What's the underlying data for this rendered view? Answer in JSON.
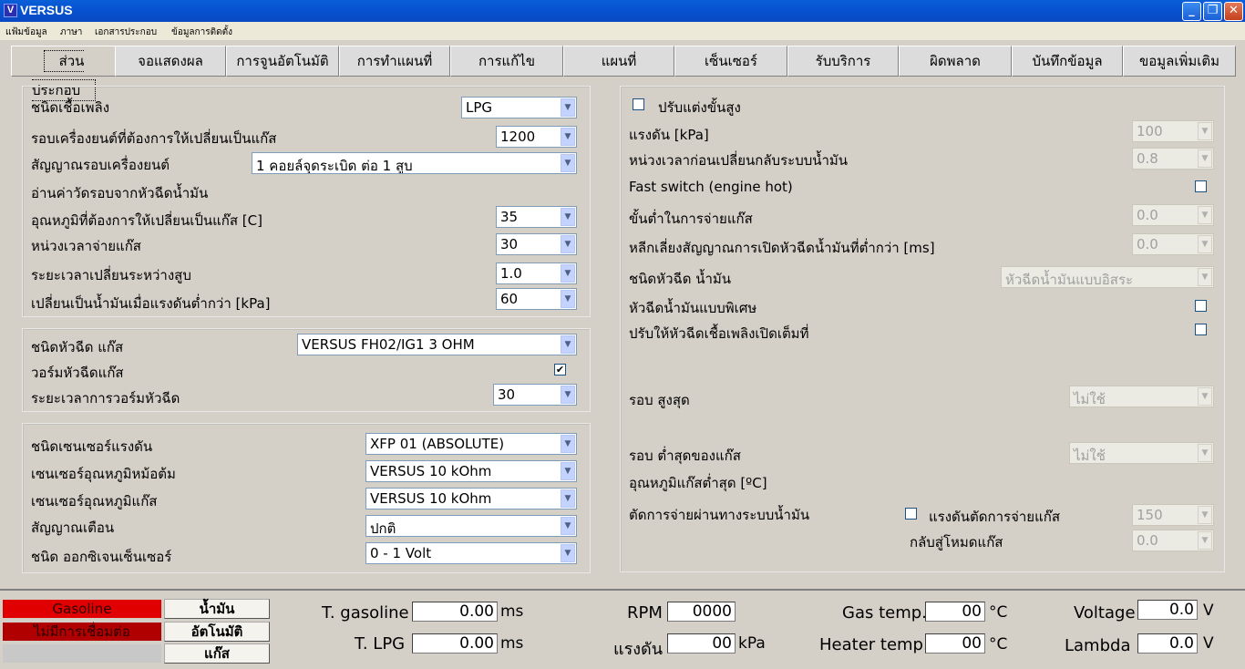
{
  "window": {
    "title": "VERSUS",
    "icon": "versus-logo-icon"
  },
  "menu": [
    "แฟ้มข้อมูล",
    "ภาษา",
    "เอกสารประกอบ",
    "ข้อมูลการติดตั้ง"
  ],
  "tabs": [
    "ส่วนประกอบ",
    "จอแสดงผล",
    "การจูนอัตโนมัติ",
    "การทำแผนที่",
    "การแก้ไข",
    "แผนที่",
    "เซ็นเซอร์",
    "รับบริการ",
    "ผิดพลาด",
    "บันทึกข้อมูล",
    "ขอมูลเพิ่มเติม"
  ],
  "left": {
    "fuel_type": {
      "label": "ชนิดเชื้อเพลิง",
      "value": "LPG"
    },
    "switch_rpm": {
      "label": "รอบเครื่องยนต์ที่ต้องการให้เปลี่ยนเป็นแก๊ส",
      "value": "1200"
    },
    "rpm_signal": {
      "label": "สัญญาณรอบเครื่องยนต์",
      "value": "1 คอยล์จุดระเบิด ต่อ 1 สูบ"
    },
    "read_rpm_label": "อ่านค่าวัดรอบจากหัวฉีดน้ำมัน",
    "switch_temp": {
      "label": "อุณหภูมิที่ต้องการให้เปลี่ยนเป็นแก๊ส [C]",
      "value": "35"
    },
    "gas_delay": {
      "label": "หน่วงเวลาจ่ายแก๊ส",
      "value": "30"
    },
    "cyl_switch_time": {
      "label": "ระยะเวลาเปลี่ยนระหว่างสูบ",
      "value": "1.0"
    },
    "min_pressure": {
      "label": "เปลี่ยนเป็นน้ำมันเมื่อแรงดันต่ำกว่า [kPa]",
      "value": "60"
    },
    "gas_injector": {
      "label": "ชนิดหัวฉีด แก๊ส",
      "value": "VERSUS FH02/IG1 3 OHM"
    },
    "injector_warmup": {
      "label": "วอร์มหัวฉีดแก๊ส",
      "checked": "✔"
    },
    "warmup_time": {
      "label": "ระยะเวลาการวอร์มหัวฉีด",
      "value": "30"
    },
    "pressure_sensor": {
      "label": "ชนิดเซนเซอร์แรงดัน",
      "value": "XFP 01 (ABSOLUTE)"
    },
    "reducer_temp_sensor": {
      "label": "เซนเซอร์อุณหภูมิหม้อต้ม",
      "value": "VERSUS 10 kOhm"
    },
    "gas_temp_sensor": {
      "label": "เซนเซอร์อุณหภูมิแก๊ส",
      "value": "VERSUS 10 kOhm"
    },
    "warning_signal": {
      "label": "สัญญาณเตือน",
      "value": "ปกติ"
    },
    "oxygen_sensor": {
      "label": "ชนิด ออกซิเจนเซ็นเซอร์",
      "value": "0 - 1 Volt"
    }
  },
  "right": {
    "advanced": {
      "label": "ปรับแต่งขั้นสูง"
    },
    "pressure": {
      "label": "แรงดัน [kPa]",
      "value": "100"
    },
    "switch_back_delay": {
      "label": "หน่วงเวลาก่อนเปลี่ยนกลับระบบน้ำมัน",
      "value": "0.8"
    },
    "fast_switch": {
      "label": "Fast switch (engine hot)"
    },
    "min_gas_dose": {
      "label": "ขั้นต่ำในการจ่ายแก๊ส",
      "value": "0.0"
    },
    "avoid_injector_signal": {
      "label": "หลีกเลี่ยงสัญญาณการเปิดหัวฉีดน้ำมันที่ต่ำกว่า  [ms]",
      "value": "0.0"
    },
    "petrol_injector_type": {
      "label": "ชนิดหัวฉีด น้ำมัน",
      "value": "หัวฉีดน้ำมันแบบอิสระ"
    },
    "special_injector": {
      "label": "หัวฉีดน้ำมันแบบพิเศษ"
    },
    "full_open_injector": {
      "label": "ปรับให้หัวฉีดเชื้อเพลิงเปิดเต็มที่"
    },
    "max_rpm": {
      "label": "รอบ สูงสุด",
      "value": "ไม่ใช้"
    },
    "min_gas_rpm": {
      "label": "รอบ ต่ำสุดของแก๊ส",
      "value": "ไม่ใช้"
    },
    "min_gas_temp": {
      "label": "อุณหภูมิแก๊สต่ำสุด [ºC]"
    },
    "cut_via_petrol": {
      "label": "ตัดการจ่ายผ่านทางระบบน้ำมัน"
    },
    "cut_pressure": {
      "label": "แรงดันตัดการจ่ายแก๊ส",
      "value": "150"
    },
    "return_gas_mode": {
      "label": "กลับสู่โหมดแก๊ส",
      "value": "0.0"
    }
  },
  "status": {
    "fuel_indicator": "Gasoline",
    "connection_indicator": "ไม่มีการเชื่อมต่อ",
    "btn_petrol": "น้ำมัน",
    "btn_auto": "อัตโนมัติ",
    "btn_gas": "แก๊ส",
    "t_gasoline": {
      "label": "T. gasoline",
      "value": "0.00",
      "unit": "ms"
    },
    "t_lpg": {
      "label": "T. LPG",
      "value": "0.00",
      "unit": "ms"
    },
    "rpm": {
      "label": "RPM",
      "value": "0000"
    },
    "pressure": {
      "label": "แรงดัน",
      "value": "00",
      "unit": "kPa"
    },
    "gas_temp": {
      "label": "Gas temp.",
      "value": "00",
      "unit": "°C"
    },
    "heater_temp": {
      "label": "Heater temp.",
      "value": "00",
      "unit": "°C"
    },
    "voltage": {
      "label": "Voltage",
      "value": "0.0",
      "unit": "V"
    },
    "lambda": {
      "label": "Lambda",
      "value": "0.0",
      "unit": "V"
    }
  },
  "colors": {
    "titlebar": "#0653d1",
    "gasoline_indicator": "#e00000",
    "connection_indicator": "#b00000"
  }
}
